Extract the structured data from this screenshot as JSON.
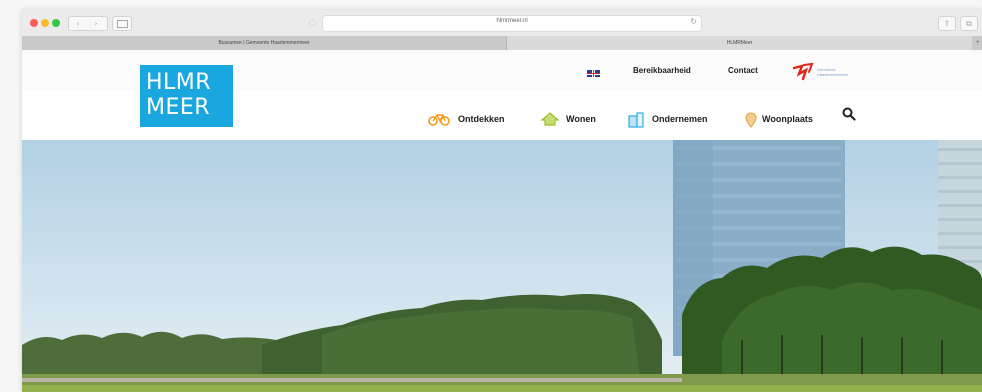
{
  "browser": {
    "url": "hlmrmeer.nl",
    "tabs": [
      {
        "title": "Bussumse | Gemeente Haarlemmermeer"
      },
      {
        "title": "HLMRMeer"
      }
    ],
    "new_tab_label": "+",
    "back_glyph": "‹",
    "forward_glyph": "›",
    "reload_glyph": "↻",
    "share_glyph": "⇪",
    "tabs_glyph": "⧉",
    "small_share_glyph": "◌",
    "icons": [
      "close-dot",
      "minimize-dot",
      "zoom-dot",
      "back-icon",
      "forward-icon",
      "sidebar-icon",
      "reload-icon",
      "share-icon",
      "tabs-overview-icon"
    ]
  },
  "site": {
    "logo_lines": [
      "HLMR",
      "MEER"
    ],
    "brand_color": "#1aa7df",
    "top_links": {
      "accessibility": "Bereikbaarheid",
      "contact": "Contact"
    },
    "municipality_caption": "Gemeente Haarlemmermeer",
    "main_nav": [
      {
        "label": "Ontdekken",
        "icon": "bicycle-icon",
        "color": "#f39b1b"
      },
      {
        "label": "Wonen",
        "icon": "house-icon",
        "color": "#9bbf2a"
      },
      {
        "label": "Ondernemen",
        "icon": "building-icon",
        "color": "#1aa7df"
      },
      {
        "label": "Woonplaats",
        "icon": "pin-icon",
        "color": "#e3a43d"
      }
    ],
    "search_icon": "search-icon"
  }
}
